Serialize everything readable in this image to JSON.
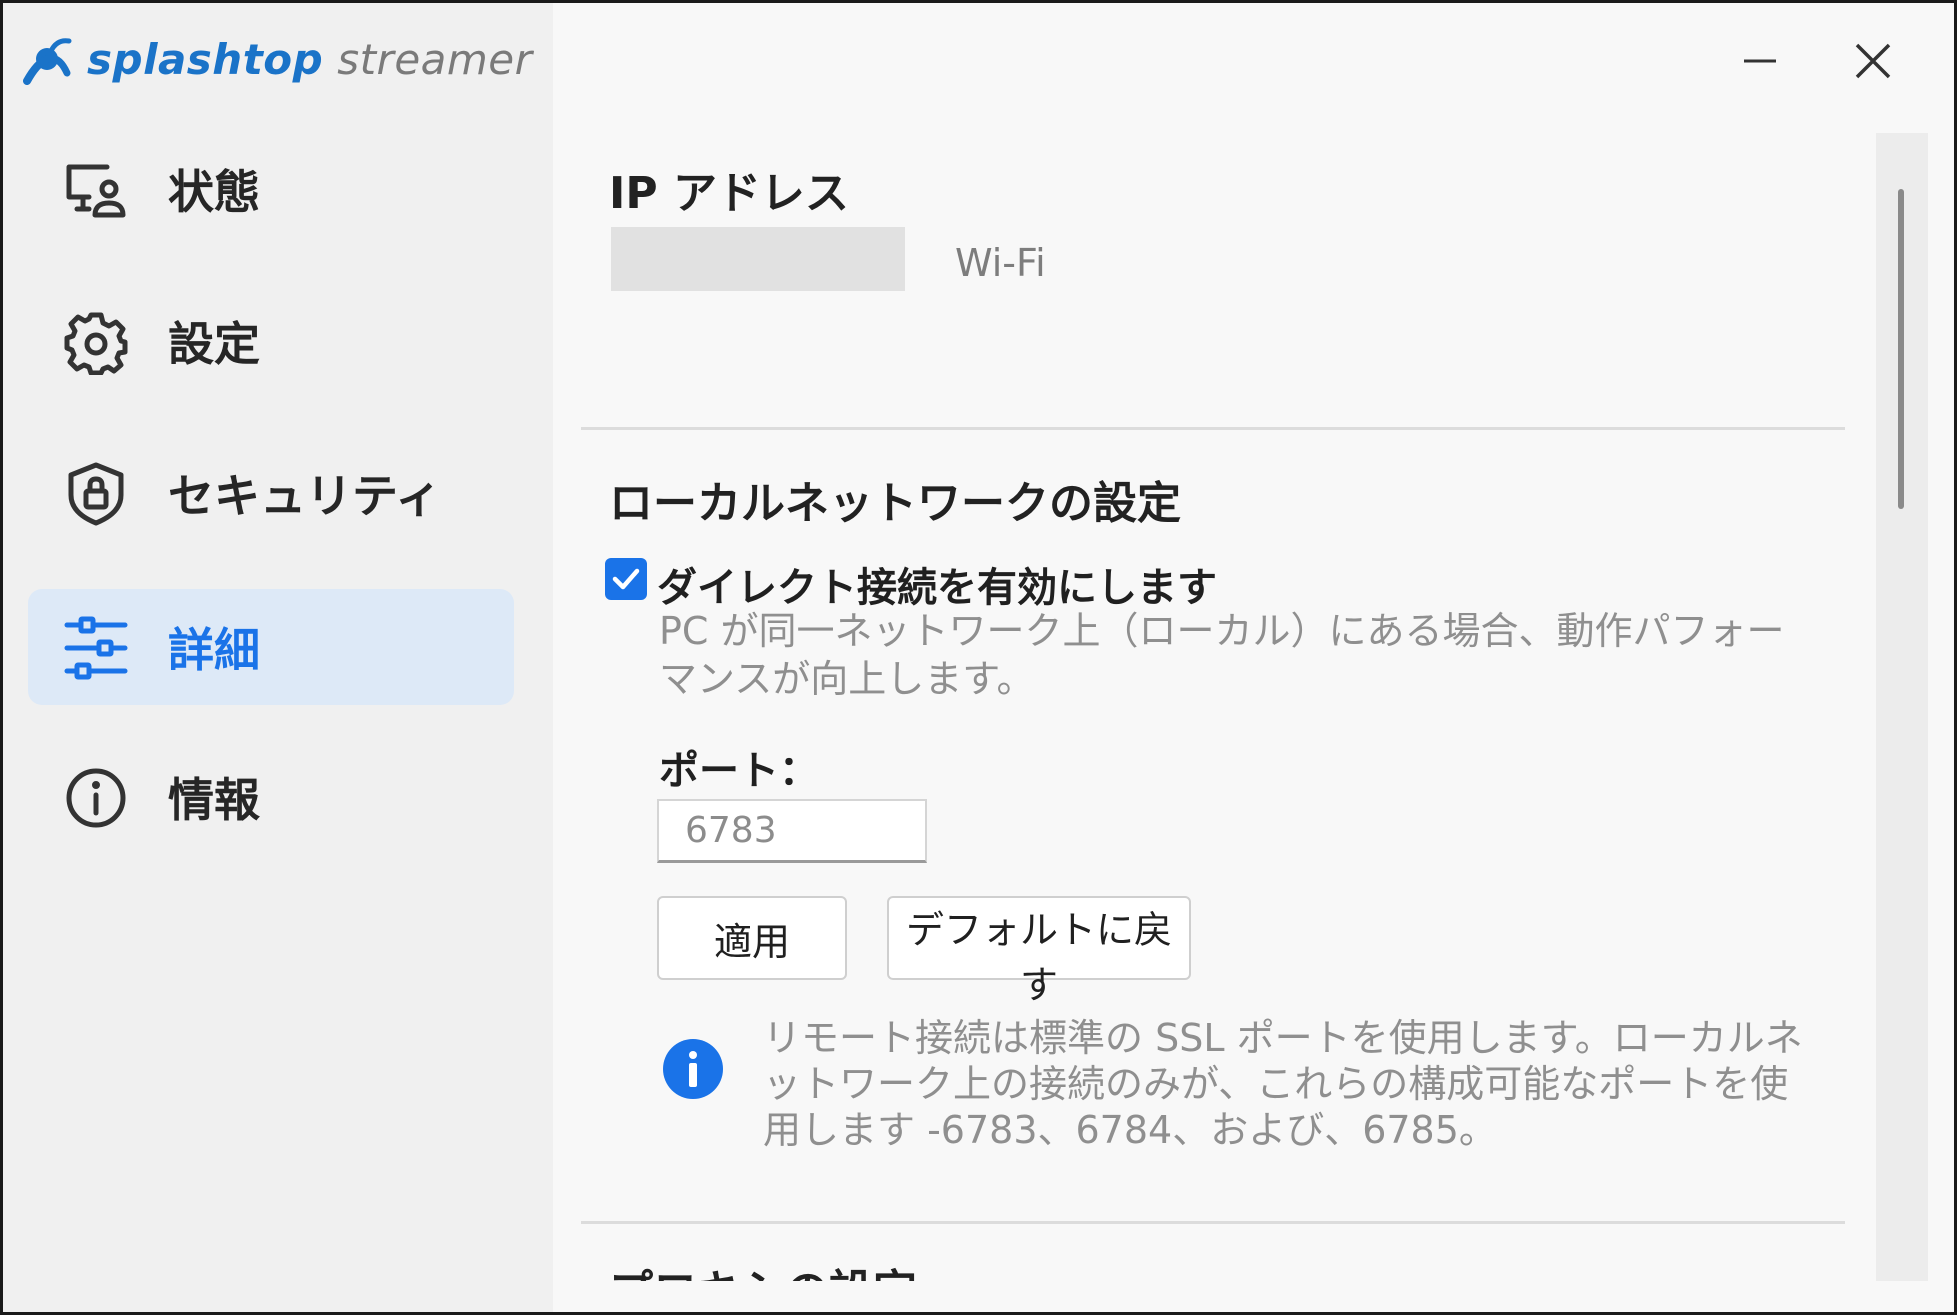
{
  "app": {
    "logo_part1": "splashtop",
    "logo_part2": "streamer",
    "accent_color": "#1a73e8"
  },
  "window_controls": {
    "minimize_icon": "minimize-icon",
    "close_icon": "close-icon"
  },
  "sidebar": {
    "items": [
      {
        "label": "状態",
        "icon": "monitor-user-icon",
        "active": false
      },
      {
        "label": "設定",
        "icon": "gear-icon",
        "active": false
      },
      {
        "label": "セキュリティ",
        "icon": "shield-lock-icon",
        "active": false
      },
      {
        "label": "詳細",
        "icon": "sliders-icon",
        "active": true
      },
      {
        "label": "情報",
        "icon": "info-circle-icon",
        "active": false
      }
    ]
  },
  "ip_section": {
    "title": "IP アドレス",
    "ip_value": "",
    "network_type": "Wi-Fi"
  },
  "local_network": {
    "title": "ローカルネットワークの設定",
    "direct_connect_label": "ダイレクト接続を有効にします",
    "direct_connect_checked": true,
    "description": "PC が同一ネットワーク上（ローカル）にある場合、動作パフォーマンスが向上します。",
    "port_label": "ポート：",
    "port_value": "6783",
    "apply_button": "適用",
    "reset_button": "デフォルトに戻す",
    "info_text": "リモート接続は標準の SSL ポートを使用します。ローカルネットワーク上の接続のみが、これらの構成可能なポートを使用します -6783、6784、および、6785。"
  },
  "proxy_section": {
    "title": "プロキシの設定"
  }
}
